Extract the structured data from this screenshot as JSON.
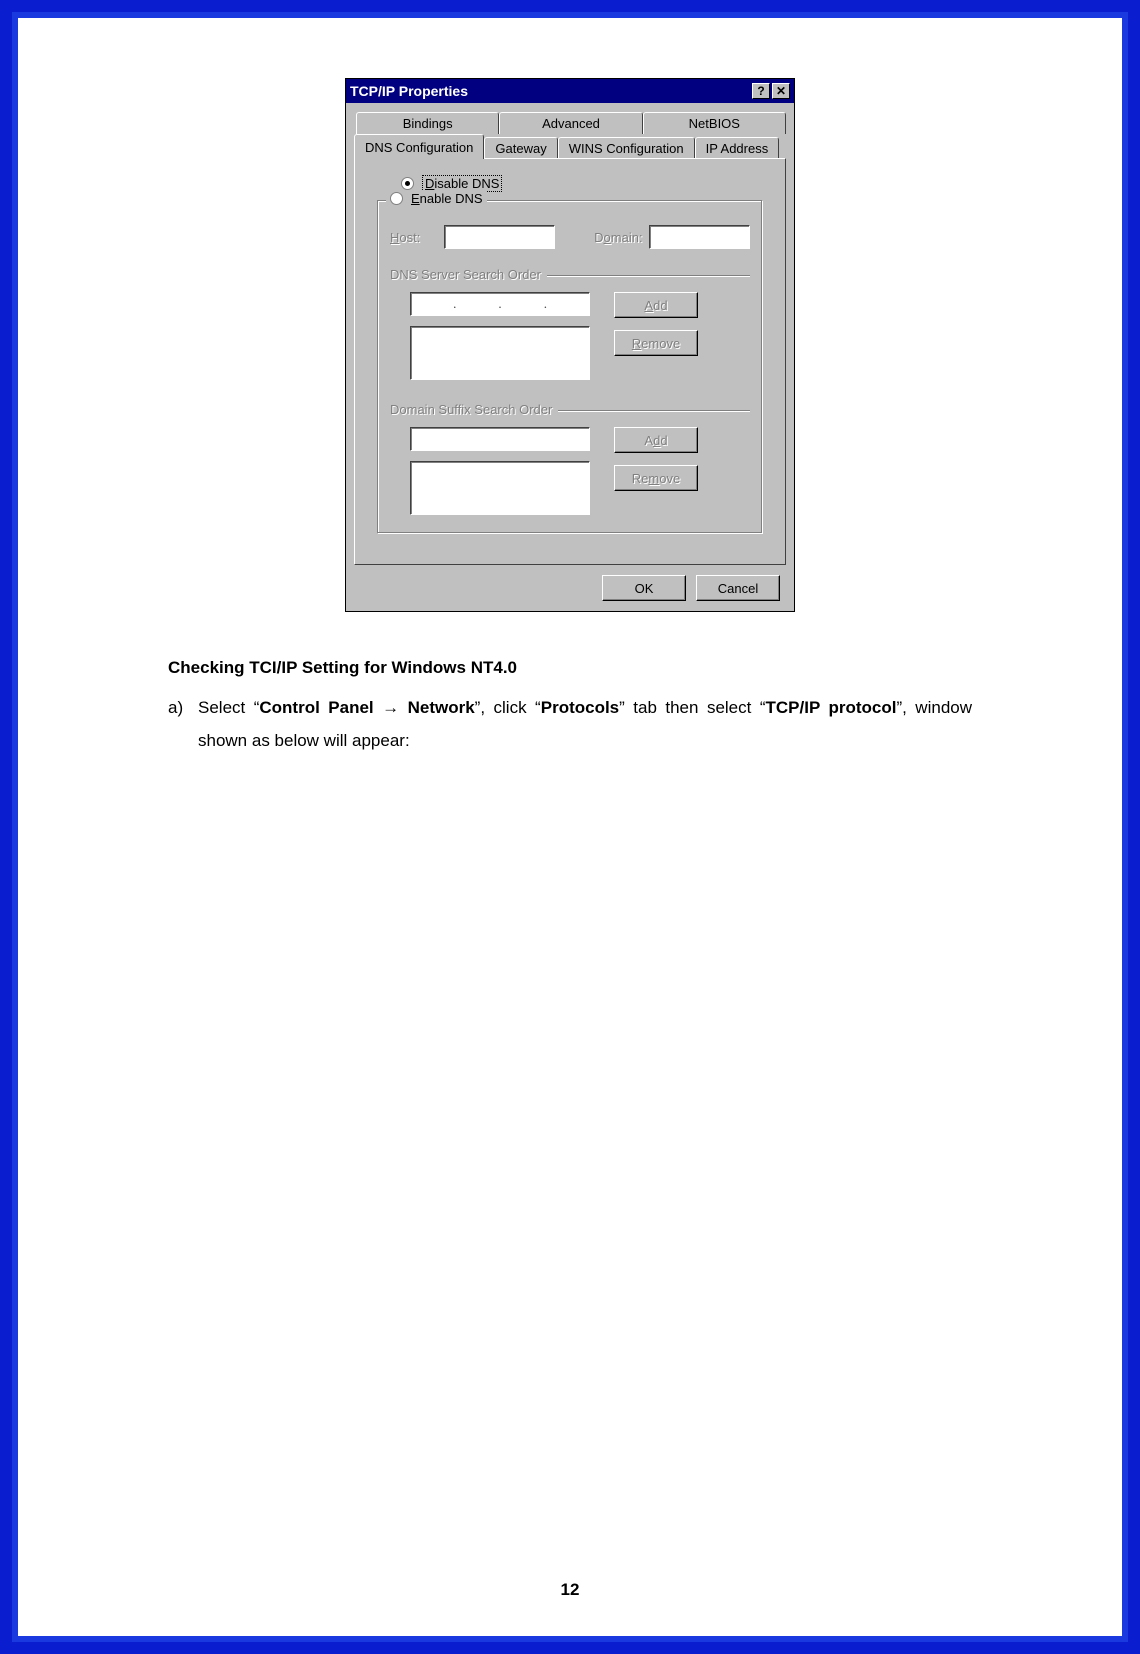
{
  "dialog": {
    "title": "TCP/IP Properties",
    "help_btn": "?",
    "close_btn": "✕",
    "tabs_row1": [
      "Bindings",
      "Advanced",
      "NetBIOS"
    ],
    "tabs_row2": [
      "DNS Configuration",
      "Gateway",
      "WINS Configuration",
      "IP Address"
    ],
    "active_tab": "DNS Configuration",
    "radio_disable": "Disable DNS",
    "radio_disable_ul": "D",
    "radio_enable": "Enable DNS",
    "radio_enable_ul": "E",
    "host_label": "Host:",
    "domain_label": "Domain:",
    "group_dns": "DNS Server Search Order",
    "group_suffix": "Domain Suffix Search Order",
    "btn_add": "Add",
    "btn_remove": "Remove",
    "btn_ok": "OK",
    "btn_cancel": "Cancel"
  },
  "doc": {
    "heading": "Checking TCI/IP Setting for Windows NT4.0",
    "step_marker": "a)",
    "step_prefix": "Select “",
    "step_bold1": "Control Panel → Network",
    "step_mid1": "”, click “",
    "step_bold2": "Protocols",
    "step_mid2": "” tab then select “",
    "step_bold3": "TCP/IP protocol",
    "step_suffix": "”, window shown as below will appear:",
    "page_number": "12"
  }
}
